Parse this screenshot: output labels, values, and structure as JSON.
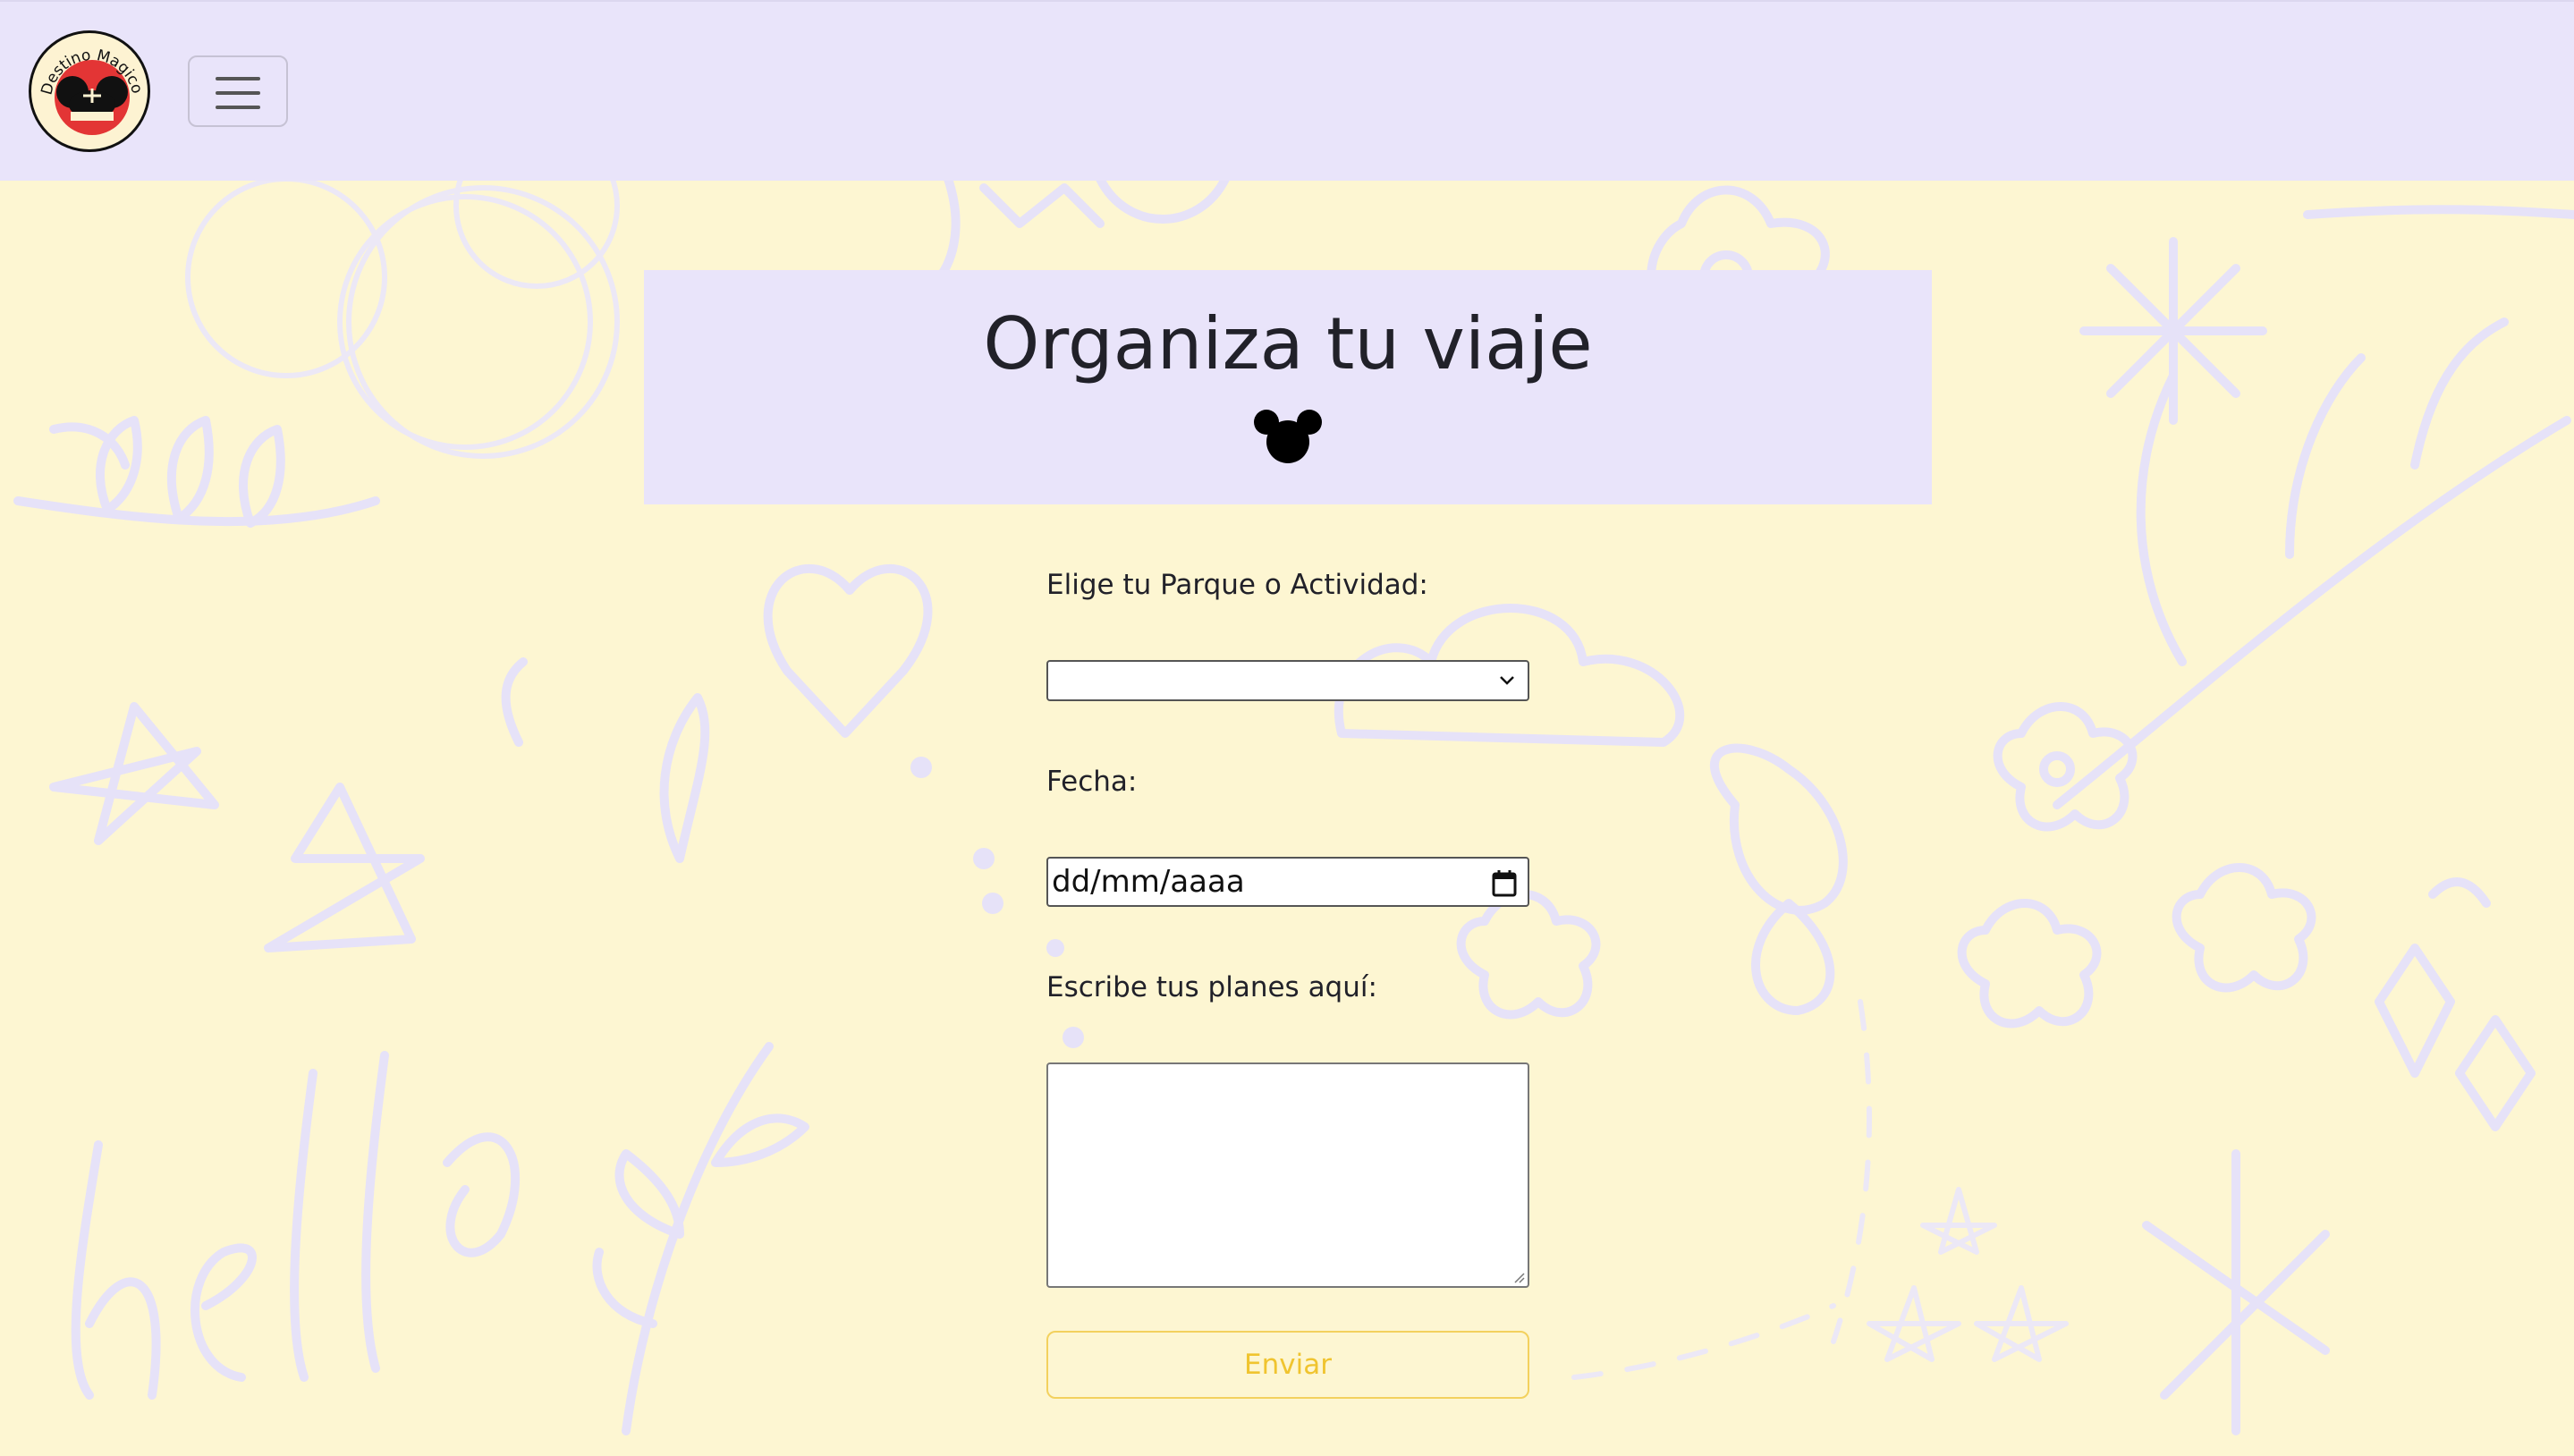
{
  "navbar": {
    "logo_text": "Destino Magico",
    "menu_button_label": "Toggle navigation"
  },
  "hero": {
    "title": "Organiza tu viaje"
  },
  "form": {
    "park_label": "Elige tu Parque o Actividad:",
    "park_selected": "",
    "date_label": "Fecha:",
    "date_placeholder": "dd/mm/aaaa",
    "plans_label": "Escribe tus planes aquí:",
    "plans_value": "",
    "submit_label": "Enviar"
  },
  "colors": {
    "background": "#fdf6d2",
    "navbar": "#e9e4fa",
    "doodle": "#e6e2f8",
    "accent": "#f3d15e",
    "text": "#212129"
  },
  "icons": [
    "logo-icon",
    "hamburger-icon",
    "mickey-icon",
    "chevron-down-icon",
    "calendar-icon",
    "resize-grip-icon"
  ]
}
